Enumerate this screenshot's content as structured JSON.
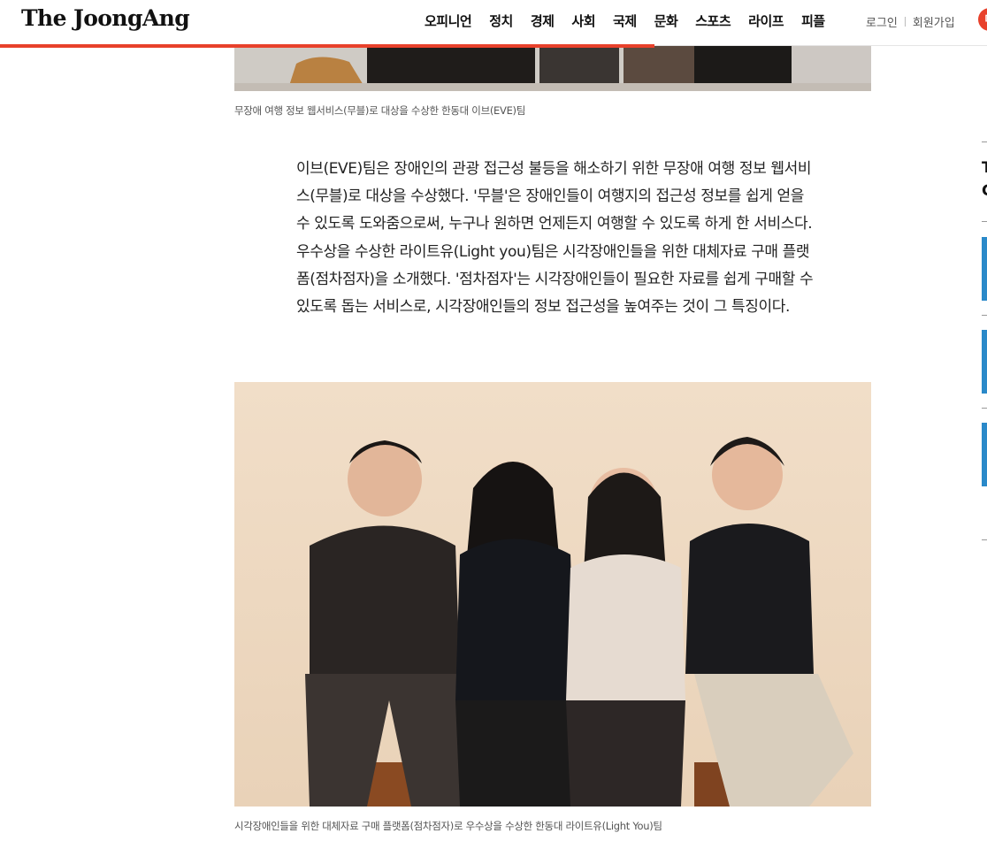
{
  "header": {
    "logo": "The JoongAng",
    "nav": [
      "오피니언",
      "정치",
      "경제",
      "사회",
      "국제",
      "문화",
      "스포츠",
      "라이프",
      "피플"
    ],
    "login": "로그인",
    "signup": "회원가입",
    "badge": "마"
  },
  "article": {
    "caption_top": "무장애 여행 정보 웹서비스(무블)로 대상을 수상한 한동대 이브(EVE)팀",
    "body": "이브(EVE)팀은 장애인의 관광 접근성 불등을 해소하기 위한 무장애 여행 정보 웹서비스(무블)로 대상을 수상했다. '무블'은 장애인들이 여행지의 접근성 정보를 쉽게 얻을 수 있도록 도와줌으로써, 누구나 원하면 언제든지 여행할 수 있도록 하게 한 서비스다. 우수상을 수상한 라이트유(Light you)팀은 시각장애인들을 위한 대체자료 구매 플랫폼(점차점자)을 소개했다. '점차점자'는 시각장애인들이 필요한 자료를 쉽게 구매할 수 있도록 돕는 서비스로, 시각장애인들의 정보 접근성을 높여주는 것이 그 특징이다.",
    "caption_bottom": "시각장애인들을 위한 대체자료 구매 플랫폼(점차점자)로 우수상을 수상한 한동대 라이트유(Light You)팀"
  },
  "rail": {
    "fragment_1": "T",
    "fragment_2": "C"
  },
  "colors": {
    "accent": "#e8412b",
    "photo_bg": "#efdbc4"
  }
}
